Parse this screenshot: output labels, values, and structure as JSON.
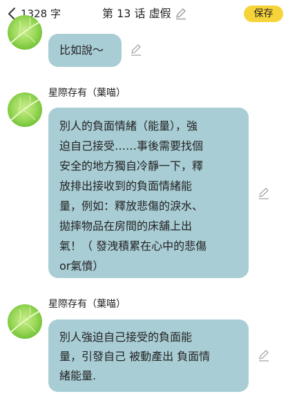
{
  "header": {
    "word_count": "1328 字",
    "chapter_title": "第 13 话 虛假",
    "save_label": "保存"
  },
  "messages": [
    {
      "lines": [
        "比如說～"
      ]
    },
    {
      "author": "星際存有（葉喵）",
      "lines": [
        "別人的負面情緒（能量），強",
        "迫自己接受……事後需要找個",
        "安全的地方獨自冷靜一下，釋",
        "放排出接收到的負面情緒能",
        "量，例如：釋放悲傷的淚水、",
        "拋摔物品在房間的床舖上出",
        "氣！（ 發洩積累在心中的悲傷",
        "or氣憤）"
      ]
    },
    {
      "author": "星際存有（葉喵）",
      "lines": [
        "別人強迫自己接受的負面能",
        "量，引發自己 被動產出 負面情",
        "緒能量."
      ]
    }
  ],
  "colors": {
    "bubble": "#a9cdd5",
    "save_button": "#f7d33a",
    "avatar": "#8fd14f"
  },
  "icons": [
    "chevron-left-icon",
    "pencil-icon",
    "leaf-avatar"
  ]
}
